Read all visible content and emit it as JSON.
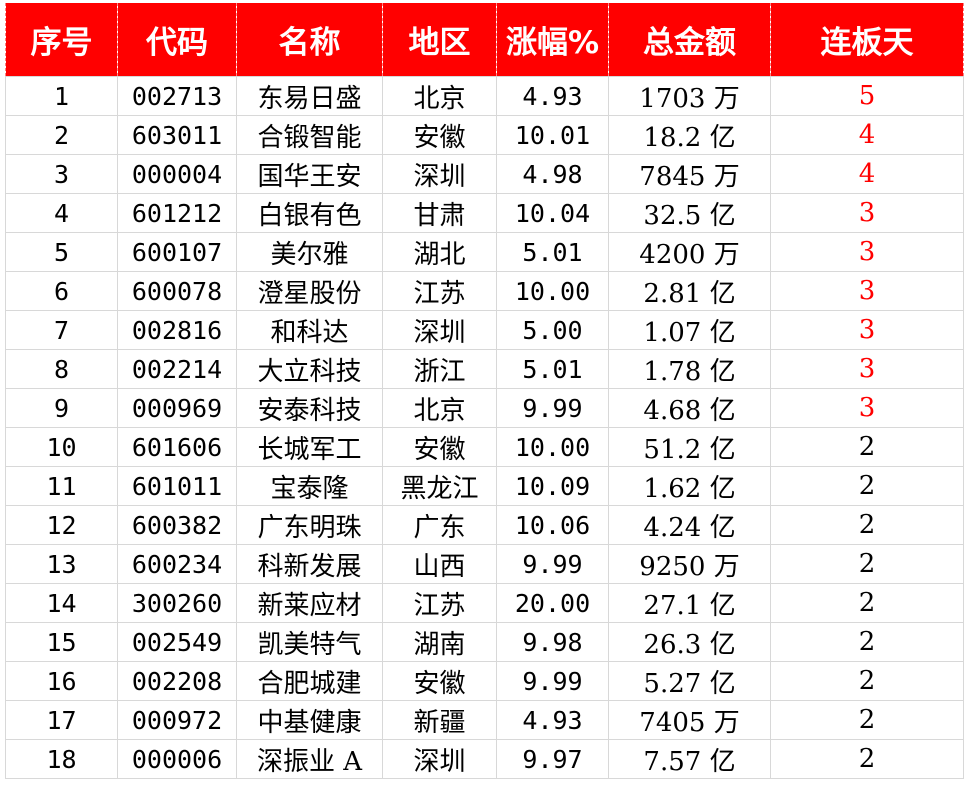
{
  "table": {
    "headers": [
      "序号",
      "代码",
      "名称",
      "地区",
      "涨幅%",
      "总金额",
      "连板天"
    ],
    "highlight_color": "#ff0000",
    "rows": [
      [
        "1",
        "002713",
        "东易日盛",
        "北京",
        "4.93",
        "1703 万",
        "5"
      ],
      [
        "2",
        "603011",
        "合锻智能",
        "安徽",
        "10.01",
        "18.2 亿",
        "4"
      ],
      [
        "3",
        "000004",
        "国华王安",
        "深圳",
        "4.98",
        "7845 万",
        "4"
      ],
      [
        "4",
        "601212",
        "白银有色",
        "甘肃",
        "10.04",
        "32.5 亿",
        "3"
      ],
      [
        "5",
        "600107",
        "美尔雅",
        "湖北",
        "5.01",
        "4200 万",
        "3"
      ],
      [
        "6",
        "600078",
        "澄星股份",
        "江苏",
        "10.00",
        "2.81 亿",
        "3"
      ],
      [
        "7",
        "002816",
        "和科达",
        "深圳",
        "5.00",
        "1.07 亿",
        "3"
      ],
      [
        "8",
        "002214",
        "大立科技",
        "浙江",
        "5.01",
        "1.78 亿",
        "3"
      ],
      [
        "9",
        "000969",
        "安泰科技",
        "北京",
        "9.99",
        "4.68 亿",
        "3"
      ],
      [
        "10",
        "601606",
        "长城军工",
        "安徽",
        "10.00",
        "51.2 亿",
        "2"
      ],
      [
        "11",
        "601011",
        "宝泰隆",
        "黑龙江",
        "10.09",
        "1.62 亿",
        "2"
      ],
      [
        "12",
        "600382",
        "广东明珠",
        "广东",
        "10.06",
        "4.24 亿",
        "2"
      ],
      [
        "13",
        "600234",
        "科新发展",
        "山西",
        "9.99",
        "9250 万",
        "2"
      ],
      [
        "14",
        "300260",
        "新莱应材",
        "江苏",
        "20.00",
        "27.1 亿",
        "2"
      ],
      [
        "15",
        "002549",
        "凯美特气",
        "湖南",
        "9.98",
        "26.3 亿",
        "2"
      ],
      [
        "16",
        "002208",
        "合肥城建",
        "安徽",
        "9.99",
        "5.27 亿",
        "2"
      ],
      [
        "17",
        "000972",
        "中基健康",
        "新疆",
        "4.93",
        "7405 万",
        "2"
      ],
      [
        "18",
        "000006",
        "深振业 A",
        "深圳",
        "9.97",
        "7.57 亿",
        "2"
      ]
    ]
  }
}
